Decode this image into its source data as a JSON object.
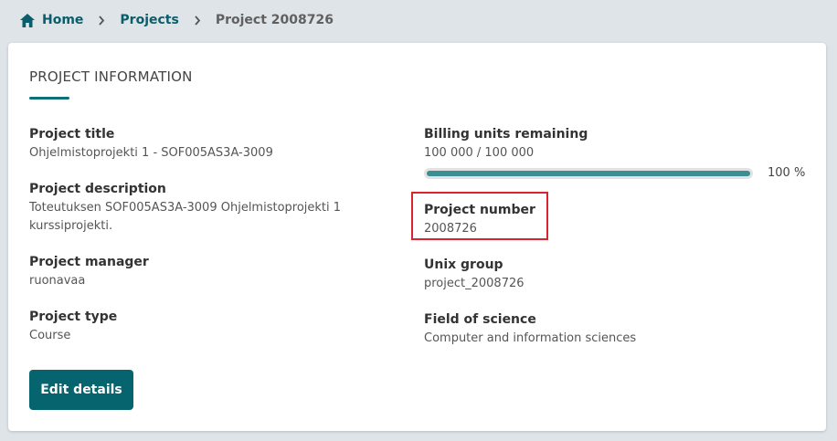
{
  "breadcrumb": {
    "home": "Home",
    "projects": "Projects",
    "current": "Project 2008726"
  },
  "card": {
    "title": "PROJECT INFORMATION"
  },
  "fields_left": [
    {
      "label": "Project title",
      "value": "Ohjelmistoprojekti 1 - SOF005AS3A-3009"
    },
    {
      "label": "Project description",
      "value": "Toteutuksen SOF005AS3A-3009 Ohjelmistoprojekti 1 kurssiprojekti."
    },
    {
      "label": "Project manager",
      "value": "ruonavaa"
    },
    {
      "label": "Project type",
      "value": "Course"
    }
  ],
  "billing": {
    "label": "Billing units remaining",
    "value": "100 000 / 100 000",
    "percent_text": "100 %",
    "fraction": 1.0
  },
  "fields_right": [
    {
      "label": "Project number",
      "value": "2008726"
    },
    {
      "label": "Unix group",
      "value": "project_2008726"
    },
    {
      "label": "Field of science",
      "value": "Computer and information sciences"
    }
  ],
  "actions": {
    "edit_label": "Edit details"
  },
  "colors": {
    "accent": "#06646e",
    "progress": "#3b8e93",
    "highlight": "#d9232e"
  },
  "icons": {
    "home": "home-icon",
    "separator": "chevron-right-icon"
  }
}
